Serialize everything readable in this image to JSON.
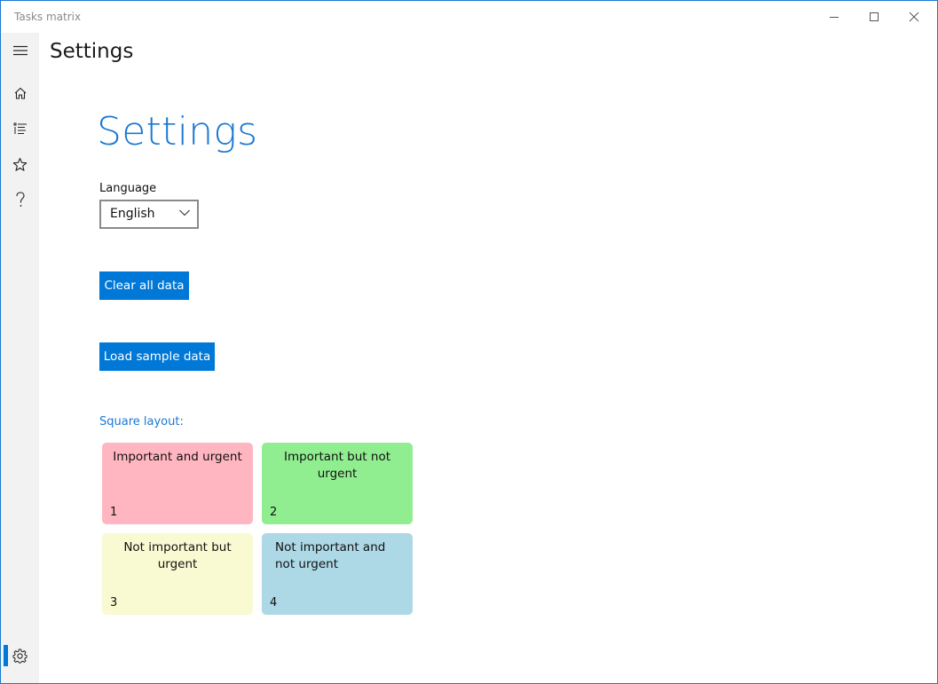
{
  "window": {
    "title": "Tasks matrix"
  },
  "nav": {
    "items": [
      {
        "name": "home",
        "icon": "home-icon"
      },
      {
        "name": "list",
        "icon": "list-icon"
      },
      {
        "name": "favorites",
        "icon": "star-icon"
      },
      {
        "name": "help",
        "icon": "question-icon"
      },
      {
        "name": "settings",
        "icon": "gear-icon",
        "selected": true
      }
    ]
  },
  "header": {
    "title": "Settings"
  },
  "settings": {
    "title": "Settings",
    "language_label": "Language",
    "language_value": "English",
    "clear_button": "Clear all data",
    "load_button": "Load sample data",
    "square_layout_label": "Square layout:",
    "quadrants": [
      {
        "title": "Important and urgent",
        "number": "1",
        "color": "#ffb6c1"
      },
      {
        "title": "Important but not urgent",
        "number": "2",
        "color": "#90ee90"
      },
      {
        "title": "Not important but urgent",
        "number": "3",
        "color": "#fafad2"
      },
      {
        "title": "Not important and not urgent",
        "number": "4",
        "color": "#add8e6"
      }
    ]
  },
  "colors": {
    "accent": "#0078d7",
    "window_border": "#1a78d2",
    "nav_background": "#f2f2f2"
  }
}
